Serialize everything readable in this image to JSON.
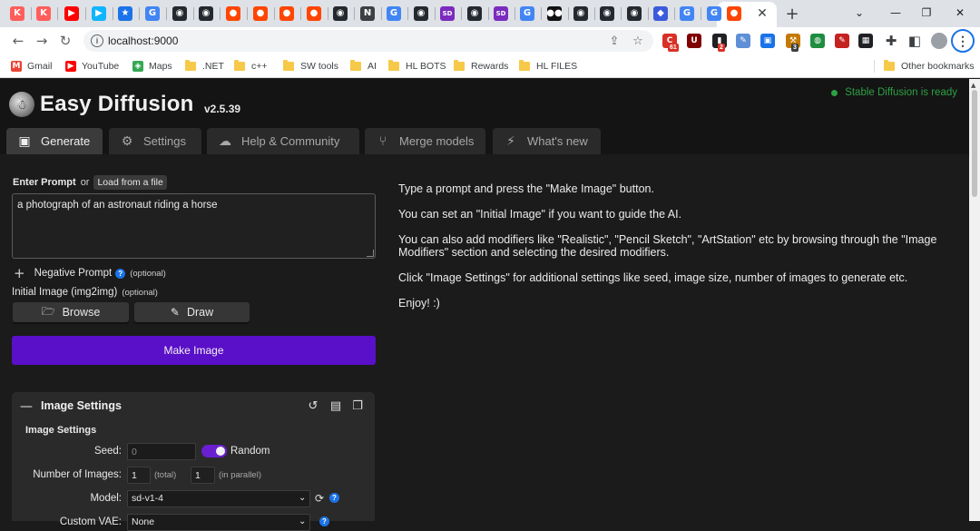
{
  "browser": {
    "tabs": [
      {
        "icon": "kofi-icon",
        "glyph": "K",
        "color": "#ff5e5b"
      },
      {
        "icon": "kofi-icon",
        "glyph": "K",
        "color": "#ff5e5b"
      },
      {
        "icon": "youtube-icon",
        "glyph": "▶",
        "color": "#ff0000"
      },
      {
        "icon": "play-icon",
        "glyph": "▶",
        "color": "#10b5ff"
      },
      {
        "icon": "star-icon",
        "glyph": "★",
        "color": "#1a73e8"
      },
      {
        "icon": "google-icon",
        "glyph": "G",
        "color": "#4285f4"
      },
      {
        "icon": "github-icon",
        "glyph": "◉",
        "color": "#24292f"
      },
      {
        "icon": "github-icon",
        "glyph": "◉",
        "color": "#24292f"
      },
      {
        "icon": "reddit-icon",
        "glyph": "●",
        "color": "#ff4500"
      },
      {
        "icon": "reddit-icon",
        "glyph": "●",
        "color": "#ff4500"
      },
      {
        "icon": "reddit-icon",
        "glyph": "●",
        "color": "#ff4500"
      },
      {
        "icon": "reddit-icon",
        "glyph": "●",
        "color": "#ff4500"
      },
      {
        "icon": "github-icon",
        "glyph": "◉",
        "color": "#24292f"
      },
      {
        "icon": "notion-icon",
        "glyph": "N",
        "color": "#3c4043"
      },
      {
        "icon": "google-icon",
        "glyph": "G",
        "color": "#4285f4"
      },
      {
        "icon": "github-icon",
        "glyph": "◉",
        "color": "#24292f"
      },
      {
        "icon": "sd-icon",
        "glyph": "SD",
        "color": "#7b2cbf"
      },
      {
        "icon": "github-icon",
        "glyph": "◉",
        "color": "#24292f"
      },
      {
        "icon": "sd-icon",
        "glyph": "SD",
        "color": "#7b2cbf"
      },
      {
        "icon": "google-icon",
        "glyph": "G",
        "color": "#4285f4"
      },
      {
        "icon": "medium-icon",
        "glyph": "●●",
        "color": "#111111"
      },
      {
        "icon": "github-icon",
        "glyph": "◉",
        "color": "#24292f"
      },
      {
        "icon": "github-icon",
        "glyph": "◉",
        "color": "#24292f"
      },
      {
        "icon": "github-icon",
        "glyph": "◉",
        "color": "#24292f"
      },
      {
        "icon": "shield-icon",
        "glyph": "◆",
        "color": "#3b5bdb"
      },
      {
        "icon": "google-icon",
        "glyph": "G",
        "color": "#4285f4"
      },
      {
        "icon": "google-icon",
        "glyph": "G",
        "color": "#4285f4"
      },
      {
        "icon": "reddit-icon",
        "glyph": "●",
        "color": "#ff4500"
      }
    ],
    "url": "localhost:9000",
    "extensions": [
      {
        "icon": "ext-red-icon",
        "glyph": "C",
        "color": "#d93025",
        "badge": "61",
        "badge_color": "#d93025"
      },
      {
        "icon": "ublock-icon",
        "glyph": "U",
        "color": "#800000",
        "badge": "",
        "badge_color": ""
      },
      {
        "icon": "ext-black-icon",
        "glyph": "▮",
        "color": "#202124",
        "badge": "2",
        "badge_color": "#d93025"
      },
      {
        "icon": "ext-pen-icon",
        "glyph": "✎",
        "color": "#5f8fd6",
        "badge": "",
        "badge_color": ""
      },
      {
        "icon": "ext-save-icon",
        "glyph": "▣",
        "color": "#1a73e8",
        "badge": "",
        "badge_color": ""
      },
      {
        "icon": "ext-hammer-icon",
        "glyph": "⚒",
        "color": "#c47a00",
        "badge": "3",
        "badge_color": "#3c4043"
      },
      {
        "icon": "ext-globe-icon",
        "glyph": "◍",
        "color": "#1e8e3e",
        "badge": "",
        "badge_color": ""
      },
      {
        "icon": "ext-pdf-icon",
        "glyph": "✎",
        "color": "#c5221f",
        "badge": "",
        "badge_color": ""
      },
      {
        "icon": "ext-grid-icon",
        "glyph": "▦",
        "color": "#202124",
        "badge": "",
        "badge_color": ""
      }
    ],
    "bookmarks": [
      {
        "label": "Gmail",
        "type": "icon",
        "glyph": "M",
        "color": "#ea4335"
      },
      {
        "label": "YouTube",
        "type": "icon",
        "glyph": "▶",
        "color": "#ff0000"
      },
      {
        "label": "Maps",
        "type": "icon",
        "glyph": "◈",
        "color": "#34a853"
      },
      {
        "label": ".NET",
        "type": "folder"
      },
      {
        "label": "c++",
        "type": "folder"
      },
      {
        "label": "SW tools",
        "type": "folder"
      },
      {
        "label": "AI",
        "type": "folder"
      },
      {
        "label": "HL BOTS",
        "type": "folder"
      },
      {
        "label": "Rewards",
        "type": "folder"
      },
      {
        "label": "HL FILES",
        "type": "folder"
      }
    ],
    "other_bookmarks": "Other bookmarks"
  },
  "app": {
    "title": "Easy Diffusion",
    "version": "v2.5.39",
    "status": "Stable Diffusion is ready",
    "tabs": [
      {
        "label": "Generate",
        "icon": "image-icon",
        "glyph": "▣"
      },
      {
        "label": "Settings",
        "icon": "gear-icon",
        "glyph": "⚙"
      },
      {
        "label": "Help & Community",
        "icon": "chat-icon",
        "glyph": "☁"
      },
      {
        "label": "Merge models",
        "icon": "branch-icon",
        "glyph": "⑂"
      },
      {
        "label": "What's new",
        "icon": "bolt-icon",
        "glyph": "⚡"
      }
    ],
    "prompt": {
      "label": "Enter Prompt",
      "or": "or",
      "load_button": "Load from a file",
      "value": "a photograph of an astronaut riding a horse"
    },
    "negative_prompt": {
      "label": "Negative Prompt",
      "optional": "(optional)"
    },
    "initial_image": {
      "label": "Initial Image (img2img)",
      "optional": "(optional)"
    },
    "browse_label": "Browse",
    "draw_label": "Draw",
    "make_image_label": "Make Image",
    "image_settings": {
      "title": "Image Settings",
      "subtitle": "Image Settings",
      "seed_label": "Seed:",
      "seed_value": "0",
      "random_label": "Random",
      "num_images_label": "Number of Images:",
      "num_total": "1",
      "total_hint": "(total)",
      "num_parallel": "1",
      "parallel_hint": "(in parallel)",
      "model_label": "Model:",
      "model_value": "sd-v1-4",
      "vae_label": "Custom VAE:",
      "vae_value": "None"
    },
    "info": [
      "Type a prompt and press the \"Make Image\" button.",
      "You can set an \"Initial Image\" if you want to guide the AI.",
      "You can also add modifiers like \"Realistic\", \"Pencil Sketch\", \"ArtStation\" etc by browsing through the \"Image Modifiers\" section and selecting the desired modifiers.",
      "Click \"Image Settings\" for additional settings like seed, image size, number of images to generate etc.",
      "Enjoy! :)"
    ]
  }
}
